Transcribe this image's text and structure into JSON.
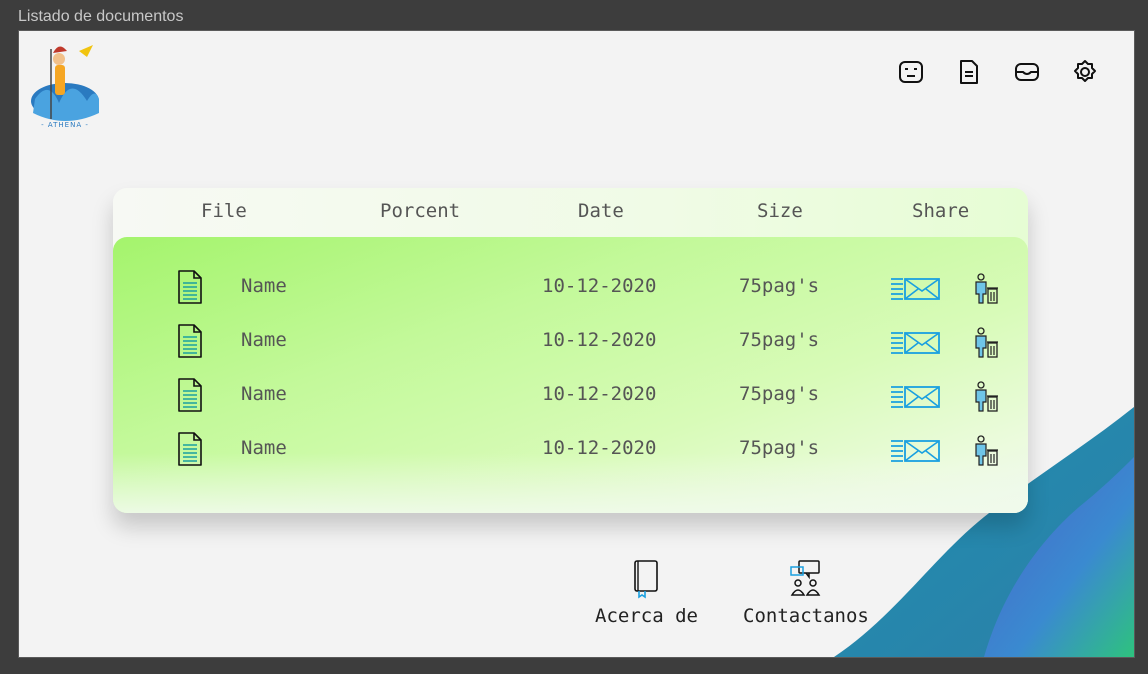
{
  "window": {
    "title": "Listado de documentos"
  },
  "logo": {
    "text": "- ATHENA -"
  },
  "topbar": {
    "icons": [
      "face-icon",
      "document-icon",
      "inbox-icon",
      "settings-icon"
    ]
  },
  "table": {
    "headers": {
      "file": "File",
      "percent": "Porcent",
      "date": "Date",
      "size": "Size",
      "share": "Share"
    },
    "rows": [
      {
        "name": "Name",
        "percent": "",
        "date": "10-12-2020",
        "size": "75pag's"
      },
      {
        "name": "Name",
        "percent": "",
        "date": "10-12-2020",
        "size": "75pag's"
      },
      {
        "name": "Name",
        "percent": "",
        "date": "10-12-2020",
        "size": "75pag's"
      },
      {
        "name": "Name",
        "percent": "",
        "date": "10-12-2020",
        "size": "75pag's"
      }
    ]
  },
  "footer": {
    "about_label": "Acerca de",
    "contact_label": "Contactanos"
  },
  "colors": {
    "accent_green": "#a4f46c",
    "wave_blue": "#2f6fbf",
    "wave_green": "#2ec27e",
    "icon_blue": "#1aa0e0"
  }
}
